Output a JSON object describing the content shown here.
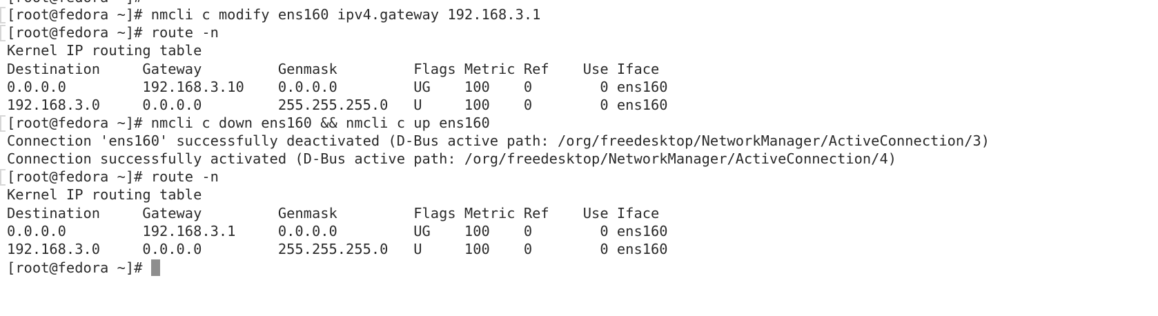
{
  "terminal": {
    "partial_top_line": "[root@fedora ~]#",
    "lines": [
      "[root@fedora ~]# nmcli c modify ens160 ipv4.gateway 192.168.3.1",
      "[root@fedora ~]# route -n",
      "Kernel IP routing table",
      "Destination     Gateway         Genmask         Flags Metric Ref    Use Iface",
      "0.0.0.0         192.168.3.10    0.0.0.0         UG    100    0        0 ens160",
      "192.168.3.0     0.0.0.0         255.255.255.0   U     100    0        0 ens160",
      "[root@fedora ~]# nmcli c down ens160 && nmcli c up ens160",
      "Connection 'ens160' successfully deactivated (D-Bus active path: /org/freedesktop/NetworkManager/ActiveConnection/3)",
      "Connection successfully activated (D-Bus active path: /org/freedesktop/NetworkManager/ActiveConnection/4)",
      "[root@fedora ~]# route -n",
      "Kernel IP routing table",
      "Destination     Gateway         Genmask         Flags Metric Ref    Use Iface",
      "0.0.0.0         192.168.3.1     0.0.0.0         UG    100    0        0 ens160",
      "192.168.3.0     0.0.0.0         255.255.255.0   U     100    0        0 ens160"
    ],
    "prompt": "[root@fedora ~]# "
  }
}
